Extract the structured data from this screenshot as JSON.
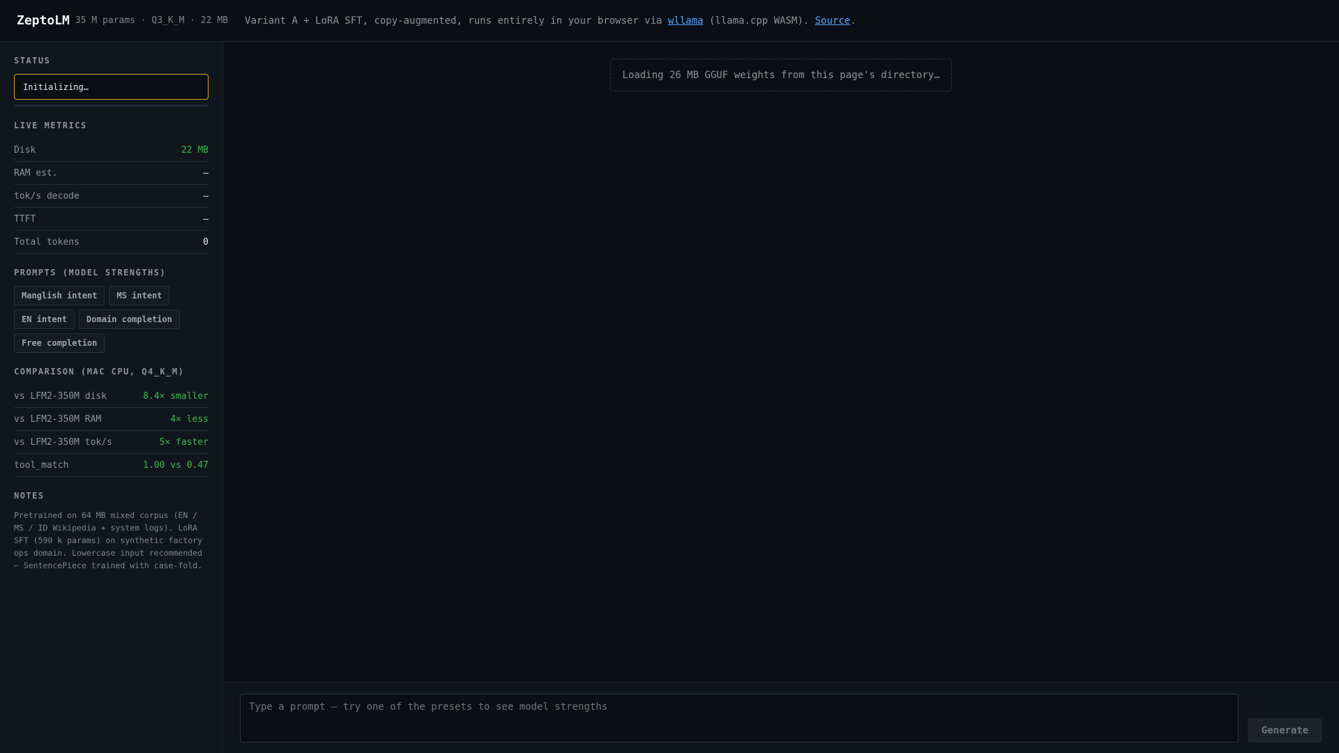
{
  "header": {
    "brand": "ZeptoLM",
    "meta": "35 M params · Q3_K_M · 22 MB",
    "tagline_prefix": "Variant A + LoRA SFT, copy-augmented, runs entirely in your browser via ",
    "wllama_link": "wllama",
    "tagline_middle": " (llama.cpp WASM). ",
    "source_link": "Source",
    "tagline_suffix": "."
  },
  "sidebar": {
    "status": {
      "title": "STATUS",
      "text": "Initializing…",
      "progress_fraction": 0.0
    },
    "metrics": {
      "title": "LIVE METRICS",
      "rows": [
        {
          "label": "Disk",
          "value": "22 MB"
        },
        {
          "label": "RAM est.",
          "value": "—"
        },
        {
          "label": "tok/s decode",
          "value": "—"
        },
        {
          "label": "TTFT",
          "value": "—"
        },
        {
          "label": "Total tokens",
          "value": "0"
        }
      ]
    },
    "prompts": {
      "title": "PROMPTS (MODEL STRENGTHS)",
      "chips": [
        "Manglish intent",
        "MS intent",
        "EN intent",
        "Domain completion",
        "Free completion"
      ]
    },
    "comparison": {
      "title": "COMPARISON (MAC CPU, Q4_K_M)",
      "rows": [
        {
          "label": "vs LFM2-350M disk",
          "value": "8.4× smaller"
        },
        {
          "label": "vs LFM2-350M RAM",
          "value": "4× less"
        },
        {
          "label": "vs LFM2-350M tok/s",
          "value": "5× faster"
        },
        {
          "label": "tool_match",
          "value": "1.00 vs 0.47"
        }
      ]
    },
    "notes": {
      "title": "NOTES",
      "text": "Pretrained on 64 MB mixed corpus (EN / MS / ID Wikipedia + system logs). LoRA SFT (590 k params) on synthetic factory ops domain. Lowercase input recommended — SentencePiece trained with case-fold."
    }
  },
  "main": {
    "loading_text": "Loading 26 MB GGUF weights from this page's directory…"
  },
  "composer": {
    "placeholder": "Type a prompt — try one of the presets to see model strengths",
    "value": "",
    "generate_label": "Generate"
  },
  "colors": {
    "accent": "#58a6ff",
    "status_border": "#d4a82a",
    "positive": "#3fb950"
  }
}
